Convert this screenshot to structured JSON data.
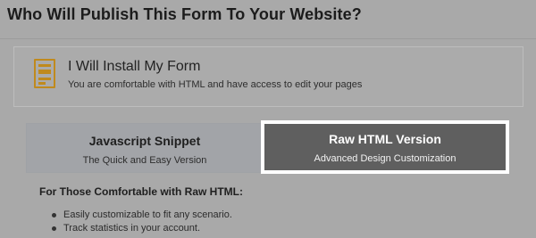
{
  "page": {
    "title": "Who Will Publish This Form To Your Website?"
  },
  "install_option": {
    "icon": "form-icon",
    "title": "I Will Install My Form",
    "subtitle": "You are comfortable with HTML and have access to edit your pages",
    "accent_color": "#c08a1d"
  },
  "tabs": [
    {
      "title": "Javascript Snippet",
      "subtitle": "The Quick and Easy Version",
      "selected": false
    },
    {
      "title": "Raw HTML Version",
      "subtitle": "Advanced Design Customization",
      "selected": true
    }
  ],
  "details": {
    "heading": "For Those Comfortable with Raw HTML:",
    "bullets": [
      "Easily customizable to fit any scenario.",
      "Track statistics in your account."
    ]
  }
}
